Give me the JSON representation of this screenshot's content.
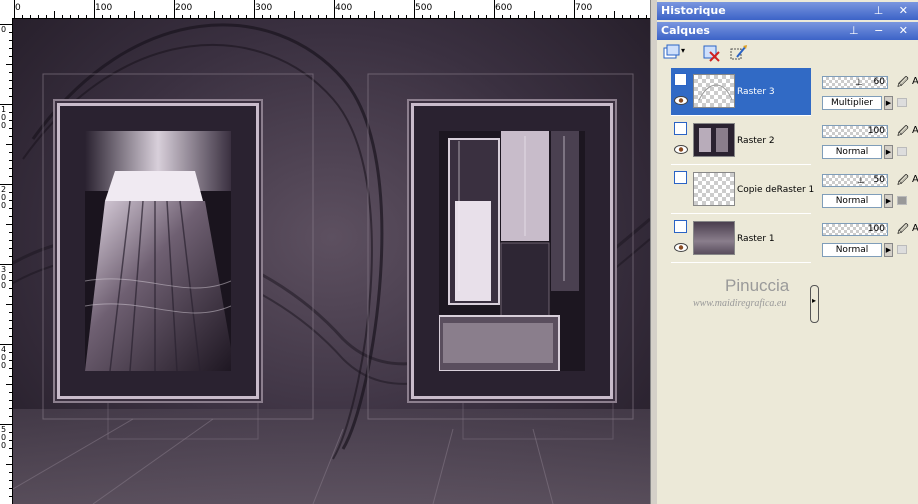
{
  "canvas": {
    "ruler_labels": [
      "0",
      "100",
      "200",
      "300",
      "400",
      "500",
      "600",
      "700"
    ],
    "left_ruler_labels": [
      "0",
      "1\n0\n0",
      "2\n0\n0",
      "3\n0\n0",
      "4\n0\n0",
      "5\n0\n0"
    ]
  },
  "history_palette": {
    "title": "Historique"
  },
  "layers_palette": {
    "title": "Calques",
    "layers": [
      {
        "name": "Raster 3",
        "opacity": "60",
        "blend": "Multiplier",
        "selected": true
      },
      {
        "name": "Raster 2",
        "opacity": "100",
        "blend": "Normal",
        "selected": false
      },
      {
        "name": "Copie deRaster 1",
        "opacity": "50",
        "blend": "Normal",
        "selected": false
      },
      {
        "name": "Raster 1",
        "opacity": "100",
        "blend": "Normal",
        "selected": false
      }
    ],
    "lock_label": "A"
  },
  "watermark": {
    "title": "Pinuccia",
    "url": "www.maidiregrafica.eu"
  },
  "colors": {
    "accent": "#316ac5",
    "titlebar": "#3c63c7",
    "canvas": "#3a3040"
  }
}
